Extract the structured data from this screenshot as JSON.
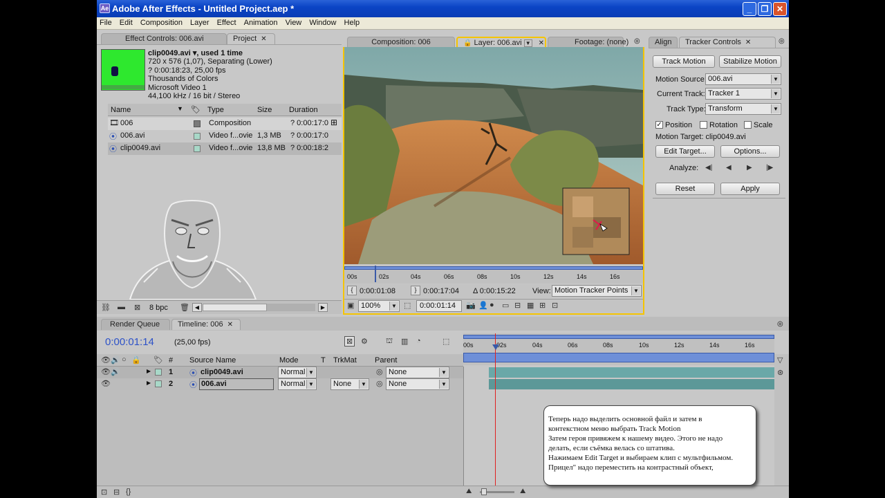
{
  "window": {
    "title": "Adobe After Effects - Untitled Project.aep *"
  },
  "menu": [
    "File",
    "Edit",
    "Composition",
    "Layer",
    "Effect",
    "Animation",
    "View",
    "Window",
    "Help"
  ],
  "project_panel": {
    "tabs": [
      {
        "label": "Effect Controls: 006.avi"
      },
      {
        "label": "Project"
      }
    ],
    "info": {
      "name": "clip0049.avi ▾, used 1 time",
      "lines": [
        "720 x 576 (1,07), Separating (Lower)",
        "? 0:00:18:23, 25,00 fps",
        "Thousands of Colors",
        "Microsoft Video 1",
        "44,100 kHz / 16 bit / Stereo"
      ]
    },
    "columns": [
      "Name",
      "Type",
      "Size",
      "Duration"
    ],
    "items": [
      {
        "name": "006",
        "type": "Composition",
        "size": "",
        "duration": "? 0:00:17:0",
        "swatch": "#7a7a7a"
      },
      {
        "name": "006.avi",
        "type": "Video f...ovie",
        "size": "1,3 MB",
        "duration": "? 0:00:17:0",
        "swatch": "#a8d8c8"
      },
      {
        "name": "clip0049.avi",
        "type": "Video f...ovie",
        "size": "13,8 MB",
        "duration": "? 0:00:18:2",
        "swatch": "#a8d8c8"
      }
    ],
    "bpc": "8 bpc"
  },
  "viewer_panel": {
    "tabs": [
      {
        "label": "Composition: 006"
      },
      {
        "label": "Layer: 006.avi"
      },
      {
        "label": "Footage: (none)"
      }
    ],
    "ruler": [
      "00s",
      "02s",
      "04s",
      "06s",
      "08s",
      "10s",
      "12s",
      "14s",
      "16s"
    ],
    "in_time": "0:00:01:08",
    "out_time": "0:00:17:04",
    "duration": "Δ 0:00:15:22",
    "view_label": "View:",
    "view_value": "Motion Tracker Points",
    "zoom": "100%",
    "current_time": "0:00:01:14"
  },
  "tracker_panel": {
    "tabs": [
      {
        "label": "Align"
      },
      {
        "label": "Tracker Controls"
      }
    ],
    "track_motion": "Track Motion",
    "stabilize_motion": "Stabilize Motion",
    "motion_source_label": "Motion Source:",
    "motion_source": "006.avi",
    "current_track_label": "Current Track:",
    "current_track": "Tracker 1",
    "track_type_label": "Track Type:",
    "track_type": "Transform",
    "position": "Position",
    "rotation": "Rotation",
    "scale": "Scale",
    "motion_target": "Motion Target: clip0049.avi",
    "edit_target": "Edit Target...",
    "options": "Options...",
    "analyze_label": "Analyze:",
    "reset": "Reset",
    "apply": "Apply"
  },
  "timeline_panel": {
    "tabs": [
      {
        "label": "Render Queue"
      },
      {
        "label": "Timeline: 006"
      }
    ],
    "timecode": "0:00:01:14",
    "fps": "(25,00 fps)",
    "columns": {
      "num": "#",
      "source": "Source Name",
      "mode": "Mode",
      "t": "T",
      "trkmat": "TrkMat",
      "parent": "Parent"
    },
    "ruler": [
      "00s",
      "02s",
      "04s",
      "06s",
      "08s",
      "10s",
      "12s",
      "14s",
      "16s"
    ],
    "layers": [
      {
        "num": "1",
        "name": "clip0049.avi",
        "mode": "Normal",
        "trkmat": "",
        "parent": "None"
      },
      {
        "num": "2",
        "name": "006.avi",
        "mode": "Normal",
        "trkmat": "None",
        "parent": "None"
      }
    ]
  },
  "annotation": {
    "lines": [
      "Теперь надо  выделить основной файл и затем в",
      "контекстном меню выбрать Track Motion",
      "Затем  героя привяжем к нашему видео. Этого не надо",
      "делать, если съёмка велась со штатива.",
      "Нажимаем Edit Target и выбираем клип с мультфильмом.",
      "Прицел\"  надо переместить на контрастный объект,"
    ]
  }
}
